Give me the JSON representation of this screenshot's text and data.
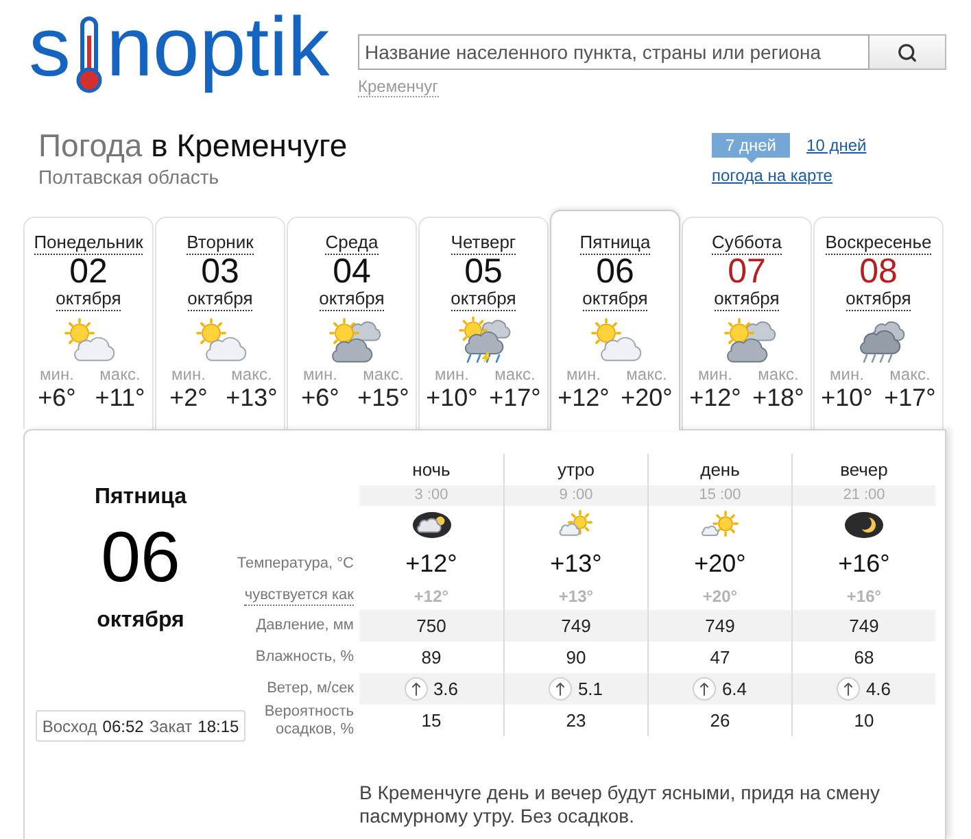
{
  "header": {
    "logo": {
      "start": "s",
      "end": "noptik"
    },
    "search": {
      "placeholder": "Название населенного пункта, страны или региона"
    },
    "recent_city": "Кременчуг"
  },
  "title": {
    "prefix": "Погода",
    "city": "в Кременчуге",
    "region": "Полтавская область"
  },
  "views": [
    {
      "label": "7 дней",
      "selected": true
    },
    {
      "label": "10 дней",
      "selected": false
    }
  ],
  "map_link": "погода на карте",
  "days": [
    {
      "weekday": "Понедельник",
      "date": "02",
      "month": "октября",
      "kind": "fair",
      "min_label": "мин.",
      "min": "+6°",
      "max_label": "макс.",
      "max": "+11°",
      "weekend": false,
      "selected": false
    },
    {
      "weekday": "Вторник",
      "date": "03",
      "month": "октября",
      "kind": "fair",
      "min_label": "мин.",
      "min": "+2°",
      "max_label": "макс.",
      "max": "+13°",
      "weekend": false,
      "selected": false
    },
    {
      "weekday": "Среда",
      "date": "04",
      "month": "октября",
      "kind": "cloudy",
      "min_label": "мин.",
      "min": "+6°",
      "max_label": "макс.",
      "max": "+15°",
      "weekend": false,
      "selected": false
    },
    {
      "weekday": "Четверг",
      "date": "05",
      "month": "октября",
      "kind": "storm",
      "min_label": "мин.",
      "min": "+10°",
      "max_label": "макс.",
      "max": "+17°",
      "weekend": false,
      "selected": false
    },
    {
      "weekday": "Пятница",
      "date": "06",
      "month": "октября",
      "kind": "fair",
      "min_label": "мин.",
      "min": "+12°",
      "max_label": "макс.",
      "max": "+20°",
      "weekend": false,
      "selected": true
    },
    {
      "weekday": "Суббота",
      "date": "07",
      "month": "октября",
      "kind": "cloudy",
      "min_label": "мин.",
      "min": "+12°",
      "max_label": "макс.",
      "max": "+18°",
      "weekend": true,
      "selected": false
    },
    {
      "weekday": "Воскресенье",
      "date": "08",
      "month": "октября",
      "kind": "rain",
      "min_label": "мин.",
      "min": "+10°",
      "max_label": "макс.",
      "max": "+17°",
      "weekend": true,
      "selected": false
    }
  ],
  "detail": {
    "weekday": "Пятница",
    "date": "06",
    "month": "октября",
    "sunrise_label": "Восход",
    "sunrise": "06:52",
    "sunset_label": "Закат",
    "sunset": "18:15",
    "labels": {
      "temperature": "Температура, °C",
      "feels_like": "чувствуется как",
      "pressure": "Давление, мм",
      "humidity": "Влажность, %",
      "wind": "Ветер, м/сек",
      "precipitation": "Вероятность осадков, %"
    },
    "periods": [
      {
        "name": "ночь",
        "time": "3 :00",
        "kind": "nightcloud",
        "temperature": "+12°",
        "feels_like": "+12°",
        "pressure": "750",
        "humidity": "89",
        "wind": "3.6",
        "precipitation": "15"
      },
      {
        "name": "утро",
        "time": "9 :00",
        "kind": "suncloud",
        "temperature": "+13°",
        "feels_like": "+13°",
        "pressure": "749",
        "humidity": "90",
        "wind": "5.1",
        "precipitation": "23"
      },
      {
        "name": "день",
        "time": "15 :00",
        "kind": "sunny",
        "temperature": "+20°",
        "feels_like": "+20°",
        "pressure": "749",
        "humidity": "47",
        "wind": "6.4",
        "precipitation": "26"
      },
      {
        "name": "вечер",
        "time": "21 :00",
        "kind": "nightclear",
        "temperature": "+16°",
        "feels_like": "+16°",
        "pressure": "749",
        "humidity": "68",
        "wind": "4.6",
        "precipitation": "10"
      }
    ],
    "description": "В Кременчуге день и вечер будут ясными, придя на смену пасмурному утру. Без осадков."
  }
}
